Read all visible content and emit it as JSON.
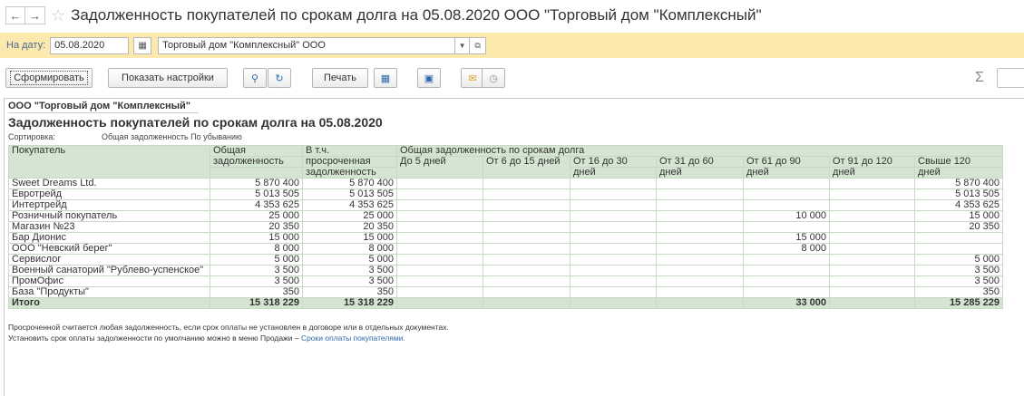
{
  "window": {
    "title": "Задолженность покупателей по срокам долга на 05.08.2020 ООО \"Торговый дом \"Комплексный\""
  },
  "params": {
    "date_label": "На дату:",
    "date_value": "05.08.2020",
    "org_value": "Торговый дом \"Комплексный\" ООО"
  },
  "toolbar": {
    "generate_label": "Сформировать",
    "settings_label": "Показать настройки",
    "print_label": "Печать",
    "sum_symbol": "Σ"
  },
  "report": {
    "company": "ООО \"Торговый дом \"Комплексный\"",
    "title": "Задолженность покупателей по срокам долга на 05.08.2020",
    "sort_key": "Сортировка:",
    "sort_value": "Общая задолженность По убыванию",
    "headers": {
      "buyer": "Покупатель",
      "total_1": "Общая",
      "total_2": "задолженность",
      "overdue_1": "В т.ч.",
      "overdue_2": "просроченная",
      "overdue_3": "задолженность",
      "by_terms": "Общая задолженность по срокам долга",
      "b1": "До 5 дней",
      "b2": "От 6 до 15 дней",
      "b3_1": "От 16 до 30",
      "b3_2": "дней",
      "b4_1": "От 31 до 60",
      "b4_2": "дней",
      "b5_1": "От 61 до 90",
      "b5_2": "дней",
      "b6_1": "От 91 до 120",
      "b6_2": "дней",
      "b7_1": "Свыше 120",
      "b7_2": "дней"
    },
    "rows": [
      {
        "name": "Sweet Dreams Ltd.",
        "total": "5 870 400",
        "overdue": "5 870 400",
        "b1": "",
        "b2": "",
        "b3": "",
        "b4": "",
        "b5": "",
        "b6": "",
        "b7": "5 870 400"
      },
      {
        "name": "Евротрейд",
        "total": "5 013 505",
        "overdue": "5 013 505",
        "b1": "",
        "b2": "",
        "b3": "",
        "b4": "",
        "b5": "",
        "b6": "",
        "b7": "5 013 505"
      },
      {
        "name": "Интертрейд",
        "total": "4 353 625",
        "overdue": "4 353 625",
        "b1": "",
        "b2": "",
        "b3": "",
        "b4": "",
        "b5": "",
        "b6": "",
        "b7": "4 353 625"
      },
      {
        "name": "Розничный покупатель",
        "total": "25 000",
        "overdue": "25 000",
        "b1": "",
        "b2": "",
        "b3": "",
        "b4": "",
        "b5": "10 000",
        "b6": "",
        "b7": "15 000"
      },
      {
        "name": "Магазин №23",
        "total": "20 350",
        "overdue": "20 350",
        "b1": "",
        "b2": "",
        "b3": "",
        "b4": "",
        "b5": "",
        "b6": "",
        "b7": "20 350"
      },
      {
        "name": "Бар Дионис",
        "total": "15 000",
        "overdue": "15 000",
        "b1": "",
        "b2": "",
        "b3": "",
        "b4": "",
        "b5": "15 000",
        "b6": "",
        "b7": ""
      },
      {
        "name": "ООО \"Невский берег\"",
        "total": "8 000",
        "overdue": "8 000",
        "b1": "",
        "b2": "",
        "b3": "",
        "b4": "",
        "b5": "8 000",
        "b6": "",
        "b7": ""
      },
      {
        "name": "Сервислог",
        "total": "5 000",
        "overdue": "5 000",
        "b1": "",
        "b2": "",
        "b3": "",
        "b4": "",
        "b5": "",
        "b6": "",
        "b7": "5 000"
      },
      {
        "name": "Военный санаторий \"Рублево-успенское\"",
        "total": "3 500",
        "overdue": "3 500",
        "b1": "",
        "b2": "",
        "b3": "",
        "b4": "",
        "b5": "",
        "b6": "",
        "b7": "3 500"
      },
      {
        "name": "ПромОфис",
        "total": "3 500",
        "overdue": "3 500",
        "b1": "",
        "b2": "",
        "b3": "",
        "b4": "",
        "b5": "",
        "b6": "",
        "b7": "3 500"
      },
      {
        "name": "База \"Продукты\"",
        "total": "350",
        "overdue": "350",
        "b1": "",
        "b2": "",
        "b3": "",
        "b4": "",
        "b5": "",
        "b6": "",
        "b7": "350"
      }
    ],
    "total_row": {
      "name": "Итого",
      "total": "15 318 229",
      "overdue": "15 318 229",
      "b1": "",
      "b2": "",
      "b3": "",
      "b4": "",
      "b5": "33 000",
      "b6": "",
      "b7": "15 285 229"
    },
    "note_1": "Просроченной считается любая задолженность, если срок оплаты не установлен в договоре или в отдельных документах.",
    "note_2_prefix": "Установить срок оплаты задолженности по умолчанию можно в меню Продажи – ",
    "note_2_link": "Сроки оплаты покупателями."
  },
  "icons": {
    "back": "arrow-left-icon",
    "forward": "arrow-right-icon",
    "favorite": "star-icon",
    "calendar": "calendar-icon",
    "search": "search-icon",
    "search_next": "search-next-icon",
    "preview": "print-preview-icon",
    "save": "save-icon",
    "email": "email-icon",
    "settings": "settings-icon"
  }
}
